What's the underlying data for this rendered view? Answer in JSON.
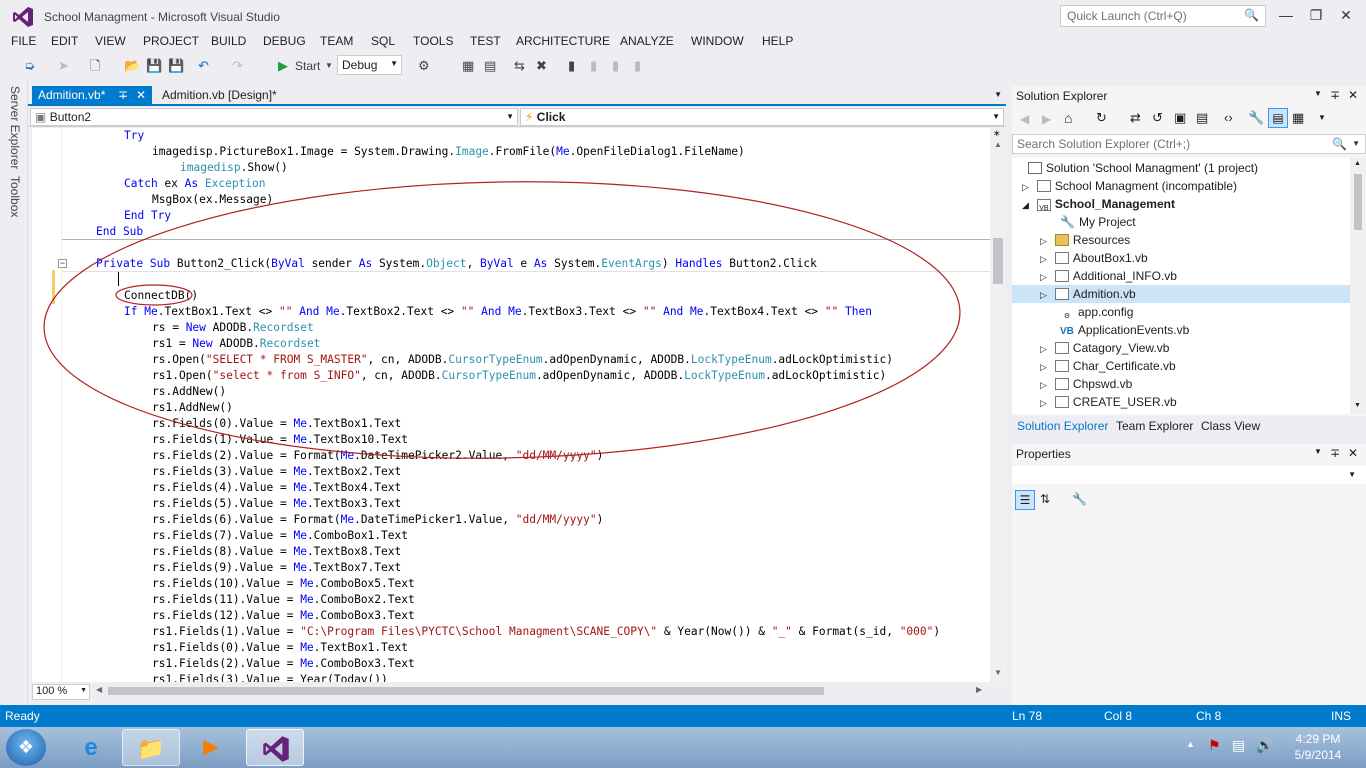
{
  "window": {
    "title": "School Managment - Microsoft Visual Studio",
    "quick_launch_placeholder": "Quick Launch (Ctrl+Q)"
  },
  "menu": [
    "FILE",
    "EDIT",
    "VIEW",
    "PROJECT",
    "BUILD",
    "DEBUG",
    "TEAM",
    "SQL",
    "TOOLS",
    "TEST",
    "ARCHITECTURE",
    "ANALYZE",
    "WINDOW",
    "HELP"
  ],
  "toolbar": {
    "start_label": "Start",
    "config_value": "Debug"
  },
  "side_tabs": [
    "Server Explorer",
    "Toolbox"
  ],
  "doc_tabs": {
    "active": "Admition.vb*",
    "other": "Admition.vb [Design]*"
  },
  "navbar": {
    "object": "Button2",
    "event": "Click"
  },
  "code": {
    "l01": [
      "Try"
    ],
    "l02": [
      "imagedisp.PictureBox1.Image = System.Drawing.",
      "Image",
      ".FromFile(",
      "Me",
      ".OpenFileDialog1.FileName)"
    ],
    "l03": [
      "imagedisp",
      ".Show()"
    ],
    "l04": [
      "Catch",
      " ex ",
      "As",
      " ",
      "Exception"
    ],
    "l05": [
      "MsgBox(ex.Message)"
    ],
    "l06": [
      "End Try"
    ],
    "l07": [
      "End Sub"
    ],
    "l08": [
      "Private Sub",
      " Button2_Click(",
      "ByVal",
      " sender ",
      "As",
      " System.",
      "Object",
      ", ",
      "ByVal",
      " e ",
      "As",
      " System.",
      "EventArgs",
      ") ",
      "Handles",
      " Button2.Click"
    ],
    "l09": [
      "ConnectDB()"
    ],
    "l10": [
      "If",
      " ",
      "Me",
      ".TextBox1.Text <> ",
      "\"\"",
      " ",
      "And",
      " ",
      "Me",
      ".TextBox2.Text <> ",
      "\"\"",
      " ",
      "And",
      " ",
      "Me",
      ".TextBox3.Text <> ",
      "\"\"",
      " ",
      "And",
      " ",
      "Me",
      ".TextBox4.Text <> ",
      "\"\"",
      " ",
      "Then"
    ],
    "l11": [
      "rs = ",
      "New",
      " ADODB.",
      "Recordset"
    ],
    "l12": [
      "rs1 = ",
      "New",
      " ADODB.",
      "Recordset"
    ],
    "l13": [
      "rs.Open(",
      "\"SELECT * FROM S_MASTER\"",
      ", cn, ADODB.",
      "CursorTypeEnum",
      ".adOpenDynamic, ADODB.",
      "LockTypeEnum",
      ".adLockOptimistic)"
    ],
    "l14": [
      "rs1.Open(",
      "\"select * from S_INFO\"",
      ", cn, ADODB.",
      "CursorTypeEnum",
      ".adOpenDynamic, ADODB.",
      "LockTypeEnum",
      ".adLockOptimistic)"
    ],
    "l15": [
      "rs.AddNew()"
    ],
    "l16": [
      "rs1.AddNew()"
    ],
    "l17": [
      "rs.Fields(0).Value = ",
      "Me",
      ".TextBox1.Text"
    ],
    "l18": [
      "rs.Fields(1).Value = ",
      "Me",
      ".TextBox10.Text"
    ],
    "l19": [
      "rs.Fields(2).Value = Format(",
      "Me",
      ".DateTimePicker2.Value, ",
      "\"dd/MM/yyyy\"",
      ")"
    ],
    "l20": [
      "rs.Fields(3).Value = ",
      "Me",
      ".TextBox2.Text"
    ],
    "l21": [
      "rs.Fields(4).Value = ",
      "Me",
      ".TextBox4.Text"
    ],
    "l22": [
      "rs.Fields(5).Value = ",
      "Me",
      ".TextBox3.Text"
    ],
    "l23": [
      "rs.Fields(6).Value = Format(",
      "Me",
      ".DateTimePicker1.Value, ",
      "\"dd/MM/yyyy\"",
      ")"
    ],
    "l24": [
      "rs.Fields(7).Value = ",
      "Me",
      ".ComboBox1.Text"
    ],
    "l25": [
      "rs.Fields(8).Value = ",
      "Me",
      ".TextBox8.Text"
    ],
    "l26": [
      "rs.Fields(9).Value = ",
      "Me",
      ".TextBox7.Text"
    ],
    "l27": [
      "rs.Fields(10).Value = ",
      "Me",
      ".ComboBox5.Text"
    ],
    "l28": [
      "rs.Fields(11).Value = ",
      "Me",
      ".ComboBox2.Text"
    ],
    "l29": [
      "rs.Fields(12).Value = ",
      "Me",
      ".ComboBox3.Text"
    ],
    "l30": [
      "rs1.Fields(1).Value = ",
      "\"C:\\Program Files\\PYCTC\\School Managment\\SCANE_COPY\\\"",
      " & Year(Now()) & ",
      "\"_\"",
      " & Format(s_id, ",
      "\"000\"",
      ")"
    ],
    "l31": [
      "rs1.Fields(0).Value = ",
      "Me",
      ".TextBox1.Text"
    ],
    "l32": [
      "rs1.Fields(2).Value = ",
      "Me",
      ".ComboBox3.Text"
    ],
    "l33": [
      "rs1.Fields(3).Value = Year(Today())"
    ]
  },
  "zoom_level": "100 %",
  "solution_explorer": {
    "title": "Solution Explorer",
    "search_placeholder": "Search Solution Explorer (Ctrl+;)",
    "items": [
      "Solution 'School Managment' (1 project)",
      "School Managment (incompatible)",
      "School_Management",
      "My Project",
      "Resources",
      "AboutBox1.vb",
      "Additional_INFO.vb",
      "Admition.vb",
      "app.config",
      "ApplicationEvents.vb",
      "Catagory_View.vb",
      "Char_Certificate.vb",
      "Chpswd.vb",
      "CREATE_USER.vb"
    ],
    "tabs": [
      "Solution Explorer",
      "Team Explorer",
      "Class View"
    ]
  },
  "properties": {
    "title": "Properties"
  },
  "status": {
    "state": "Ready",
    "line": "Ln 78",
    "col": "Col 8",
    "ch": "Ch 8",
    "mode": "INS"
  },
  "taskbar": {
    "time": "4:29 PM",
    "date": "5/9/2014"
  },
  "colors": {
    "accent": "#007acc",
    "keyword": "#0000ff",
    "type": "#2b91af",
    "string": "#a31515",
    "annotation": "#b22222"
  }
}
